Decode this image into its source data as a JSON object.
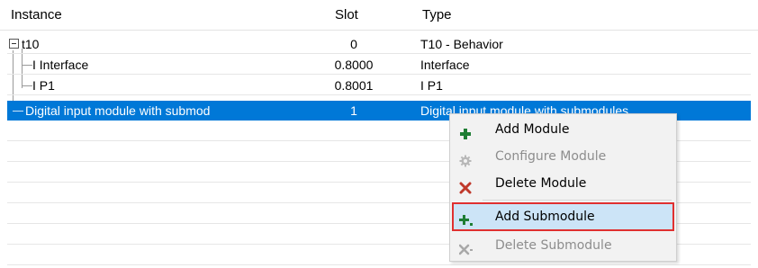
{
  "columns": {
    "instance": "Instance",
    "slot": "Slot",
    "type": "Type"
  },
  "rows": [
    {
      "instance": "t10",
      "slot": "0",
      "type": "T10 - Behavior",
      "expander": "collapse-minus"
    },
    {
      "instance": "I Interface",
      "slot": "0.8000",
      "type": "Interface"
    },
    {
      "instance": "I P1",
      "slot": "0.8001",
      "type": "I P1"
    },
    {
      "instance": "Digital input module with submod",
      "slot": "1",
      "type": "Digital input module with submodules",
      "selected": true
    }
  ],
  "context_menu": {
    "items": [
      {
        "label": "Add Module",
        "icon": "plus-icon",
        "enabled": true
      },
      {
        "label": "Configure Module",
        "icon": "gear-icon",
        "enabled": false
      },
      {
        "label": "Delete Module",
        "icon": "x-icon",
        "enabled": true
      },
      {
        "label": "Add Submodule",
        "icon": "plus-sub-icon",
        "enabled": true,
        "highlighted": true
      },
      {
        "label": "Delete Submodule",
        "icon": "x-sub-icon",
        "enabled": false
      }
    ]
  },
  "colors": {
    "selection": "#0078d7",
    "menu_highlight": "#cce4f7",
    "highlight_border": "#e03030",
    "add_green": "#1e7e34",
    "delete_red": "#c0392b"
  }
}
